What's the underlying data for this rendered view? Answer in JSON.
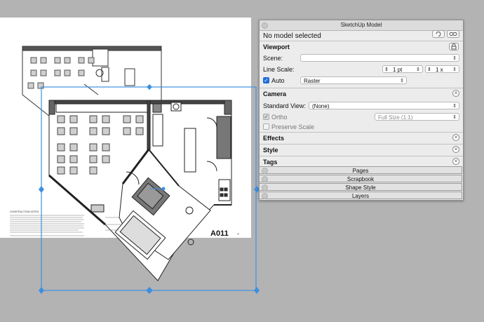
{
  "panel": {
    "title": "SketchUp Model",
    "model_status": "No model selected",
    "viewport": {
      "header": "Viewport",
      "scene_label": "Scene:",
      "scene_value": "",
      "line_scale_label": "Line Scale:",
      "line_scale_value": "1 pt",
      "line_scale_multiplier": "1 x",
      "auto_label": "Auto",
      "auto_checked": true,
      "render_mode": "Raster"
    },
    "camera": {
      "header": "Camera",
      "standard_view_label": "Standard View:",
      "standard_view_value": "(None)",
      "ortho_label": "Ortho",
      "ortho_checked": true,
      "scale_value": "Full Size (1:1)",
      "preserve_scale_label": "Preserve Scale",
      "preserve_scale_checked": false
    },
    "effects_header": "Effects",
    "style_header": "Style",
    "tags_header": "Tags"
  },
  "trays": [
    "Pages",
    "Scrapbook",
    "Shape Style",
    "Layers"
  ],
  "title_block": {
    "sheet_number": "A011",
    "revision": "-",
    "notes_heading": "CONSTRUCTION NOTES"
  },
  "colors": {
    "selection": "#3d8fe0",
    "canvas_bg": "#b3b3b3",
    "panel_bg": "#ececec",
    "checkbox_accent": "#1f6fd6"
  }
}
